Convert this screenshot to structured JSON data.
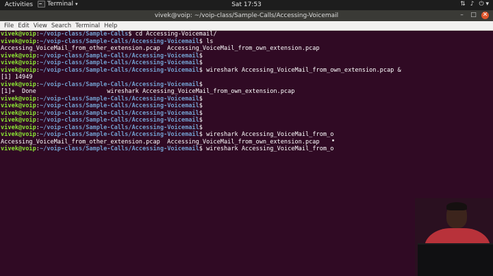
{
  "topbar": {
    "activities": "Activities",
    "app_name": "Terminal",
    "clock": "Sat 17:53",
    "tray_icons": [
      "network-icon",
      "volume-icon",
      "power-icon"
    ]
  },
  "window": {
    "title": "vivek@voip: ~/voip-class/Sample-Calls/Accessing-Voicemail"
  },
  "menu": {
    "items": [
      "File",
      "Edit",
      "View",
      "Search",
      "Terminal",
      "Help"
    ]
  },
  "terminal": {
    "lines": [
      {
        "user": "vivek@voip",
        "path": "~/voip-class/Sample-Calls",
        "cmd": "cd Accessing-Voicemail/"
      },
      {
        "user": "vivek@voip",
        "path": "~/voip-class/Sample-Calls/Accessing-Voicemail",
        "cmd": "ls"
      },
      {
        "output": "Accessing_VoiceMail_from_other_extension.pcap  Accessing_VoiceMail_from_own_extension.pcap"
      },
      {
        "user": "vivek@voip",
        "path": "~/voip-class/Sample-Calls/Accessing-Voicemail",
        "cmd": ""
      },
      {
        "user": "vivek@voip",
        "path": "~/voip-class/Sample-Calls/Accessing-Voicemail",
        "cmd": ""
      },
      {
        "user": "vivek@voip",
        "path": "~/voip-class/Sample-Calls/Accessing-Voicemail",
        "cmd": "wireshark Accessing_VoiceMail_from_own_extension.pcap &"
      },
      {
        "output": "[1] 14949"
      },
      {
        "user": "vivek@voip",
        "path": "~/voip-class/Sample-Calls/Accessing-Voicemail",
        "cmd": ""
      },
      {
        "output": "[1]+  Done                    wireshark Accessing_VoiceMail_from_own_extension.pcap"
      },
      {
        "user": "vivek@voip",
        "path": "~/voip-class/Sample-Calls/Accessing-Voicemail",
        "cmd": ""
      },
      {
        "user": "vivek@voip",
        "path": "~/voip-class/Sample-Calls/Accessing-Voicemail",
        "cmd": ""
      },
      {
        "user": "vivek@voip",
        "path": "~/voip-class/Sample-Calls/Accessing-Voicemail",
        "cmd": ""
      },
      {
        "user": "vivek@voip",
        "path": "~/voip-class/Sample-Calls/Accessing-Voicemail",
        "cmd": ""
      },
      {
        "user": "vivek@voip",
        "path": "~/voip-class/Sample-Calls/Accessing-Voicemail",
        "cmd": ""
      },
      {
        "user": "vivek@voip",
        "path": "~/voip-class/Sample-Calls/Accessing-Voicemail",
        "cmd": "wireshark Accessing_VoiceMail_from_o"
      },
      {
        "output": "Accessing_VoiceMail_from_other_extension.pcap  Accessing_VoiceMail_from_own_extension.pcap"
      },
      {
        "user": "vivek@voip",
        "path": "~/voip-class/Sample-Calls/Accessing-Voicemail",
        "cmd": "wireshark Accessing_VoiceMail_from_o"
      }
    ]
  },
  "colors": {
    "terminal_bg": "#300a24",
    "prompt_user": "#8ae234",
    "prompt_path": "#729fcf",
    "text": "#ffffff"
  }
}
